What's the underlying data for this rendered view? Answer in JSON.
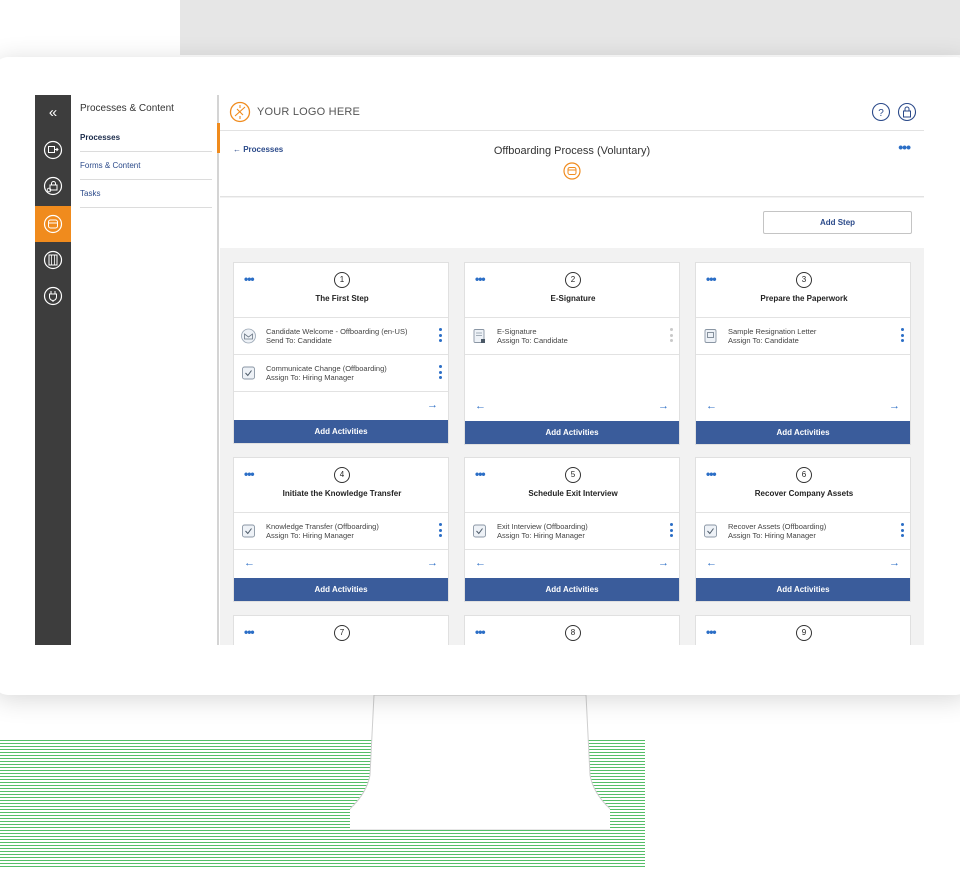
{
  "sidebar": {
    "collapse_glyph": "«",
    "icons": [
      "process-icon",
      "forms-lock-icon",
      "offboarding-icon",
      "building-icon",
      "plug-icon"
    ]
  },
  "subnav": {
    "title": "Processes & Content",
    "items": [
      {
        "label": "Processes"
      },
      {
        "label": "Forms & Content"
      },
      {
        "label": "Tasks"
      }
    ]
  },
  "header": {
    "logo_text": "YOUR LOGO HERE",
    "help_glyph": "?"
  },
  "titlebar": {
    "back_label": "← Processes",
    "title": "Offboarding Process (Voluntary)",
    "more_label": "•••"
  },
  "actionbar": {
    "add_step_label": "Add Step"
  },
  "steps": [
    {
      "number": "1",
      "title": "The First Step",
      "more": "•••",
      "activities": [
        {
          "icon": "envelope-icon",
          "name": "Candidate Welcome - Offboarding (en-US)",
          "assign": "Send To: Candidate"
        },
        {
          "icon": "checkbox-icon",
          "name": "Communicate Change (Offboarding)",
          "assign": "Assign To: Hiring Manager"
        }
      ],
      "left_arrow": "",
      "right_arrow": "→",
      "add_label": "Add Activities"
    },
    {
      "number": "2",
      "title": "E-Signature",
      "more": "•••",
      "activities": [
        {
          "icon": "signature-doc-icon",
          "name": "E-Signature",
          "assign": "Assign To: Candidate"
        }
      ],
      "left_arrow": "←",
      "right_arrow": "→",
      "add_label": "Add Activities"
    },
    {
      "number": "3",
      "title": "Prepare the Paperwork",
      "more": "•••",
      "activities": [
        {
          "icon": "document-icon",
          "name": "Sample Resignation Letter",
          "assign": "Assign To: Candidate"
        }
      ],
      "left_arrow": "←",
      "right_arrow": "→",
      "add_label": "Add Activities"
    },
    {
      "number": "4",
      "title": "Initiate the Knowledge Transfer",
      "more": "•••",
      "activities": [
        {
          "icon": "checkbox-icon",
          "name": "Knowledge Transfer (Offboarding)",
          "assign": "Assign To: Hiring Manager"
        }
      ],
      "left_arrow": "←",
      "right_arrow": "→",
      "add_label": "Add Activities"
    },
    {
      "number": "5",
      "title": "Schedule Exit Interview",
      "more": "•••",
      "activities": [
        {
          "icon": "checkbox-icon",
          "name": "Exit Interview (Offboarding)",
          "assign": "Assign To: Hiring Manager"
        }
      ],
      "left_arrow": "←",
      "right_arrow": "→",
      "add_label": "Add Activities"
    },
    {
      "number": "6",
      "title": "Recover Company Assets",
      "more": "•••",
      "activities": [
        {
          "icon": "checkbox-icon",
          "name": "Recover Assets (Offboarding)",
          "assign": "Assign To: Hiring Manager"
        }
      ],
      "left_arrow": "←",
      "right_arrow": "→",
      "add_label": "Add Activities"
    },
    {
      "number": "7",
      "more": "•••"
    },
    {
      "number": "8",
      "more": "•••"
    },
    {
      "number": "9",
      "more": "•••"
    }
  ],
  "colors": {
    "accent": "#f08b1d",
    "primary": "#3a5c9b",
    "rail": "#3d3d3d",
    "link": "#2b6ec6",
    "decor_stripes": "#37b24d"
  }
}
